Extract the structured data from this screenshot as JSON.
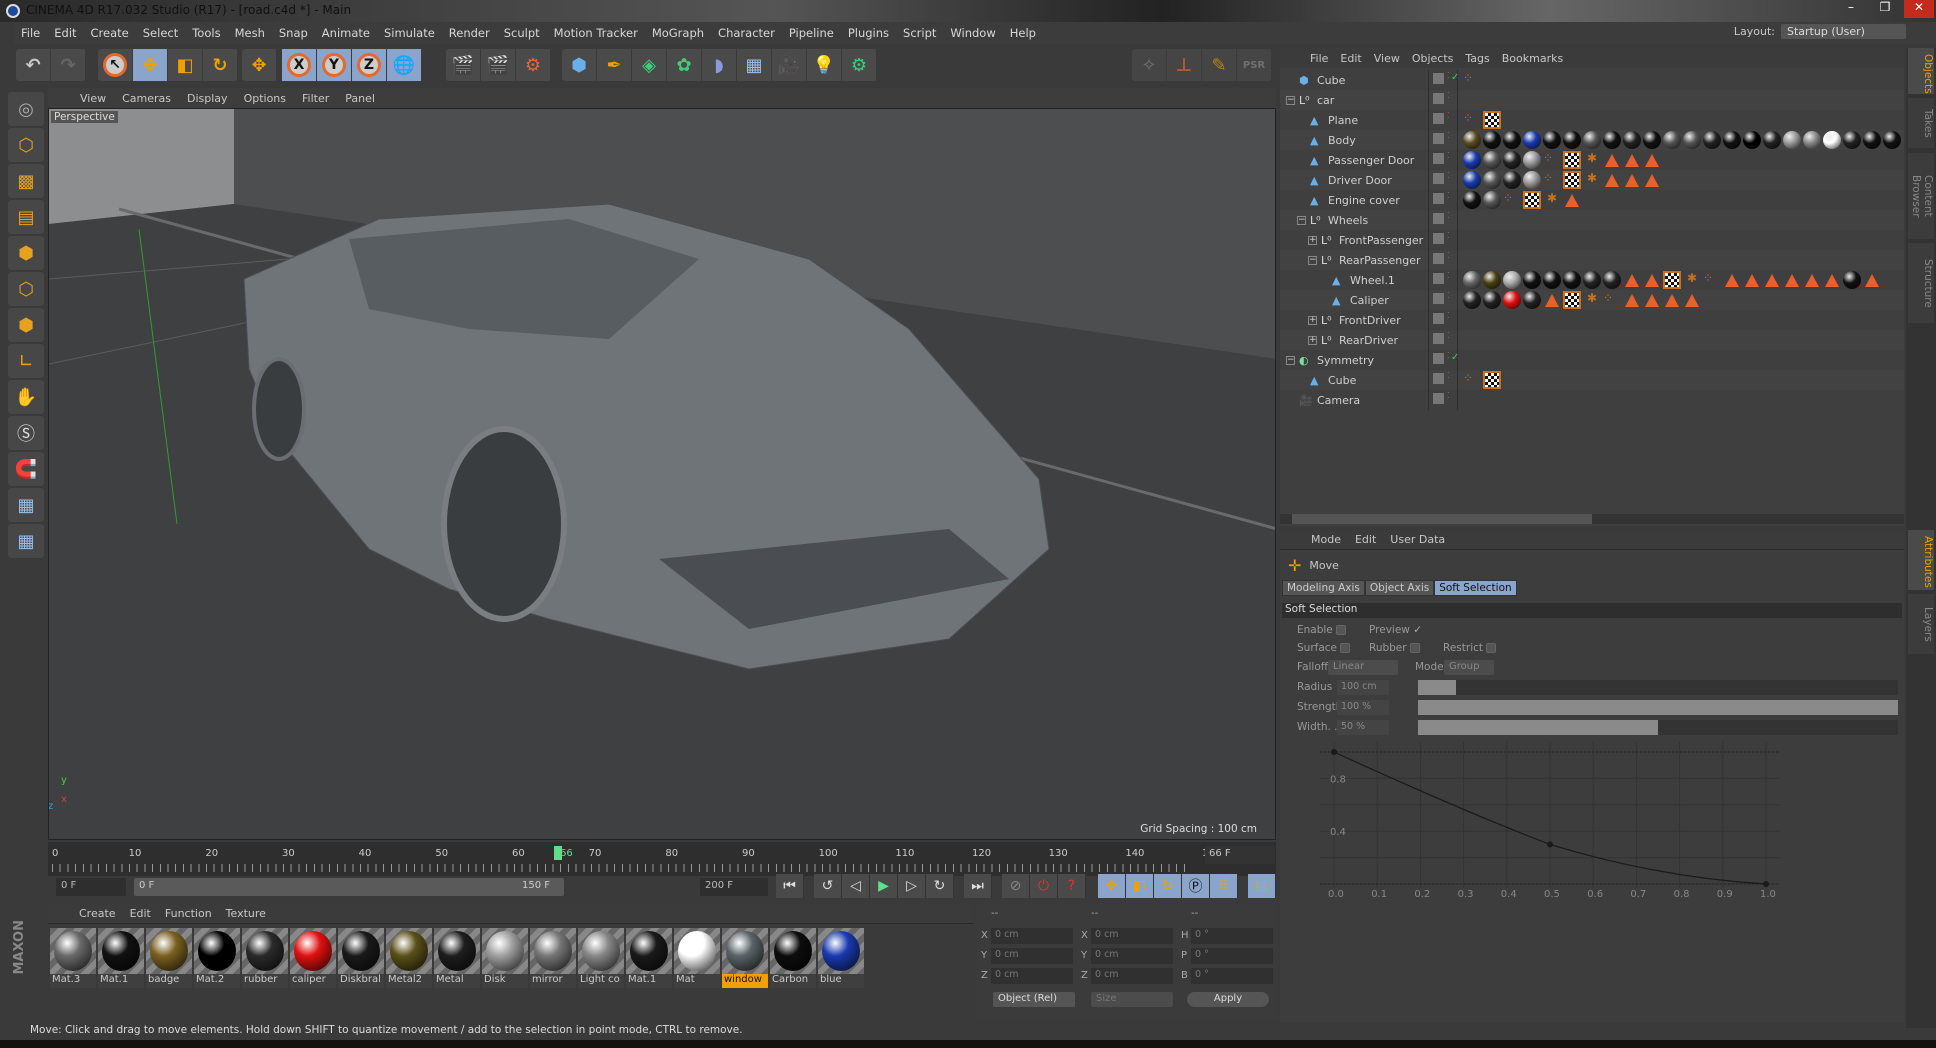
{
  "window": {
    "title": "CINEMA 4D R17.032 Studio (R17) - [road.c4d *] - Main",
    "controls": [
      "–",
      "❐",
      "✕"
    ]
  },
  "menu": [
    "File",
    "Edit",
    "Create",
    "Select",
    "Tools",
    "Mesh",
    "Snap",
    "Animate",
    "Simulate",
    "Render",
    "Sculpt",
    "Motion Tracker",
    "MoGraph",
    "Character",
    "Pipeline",
    "Plugins",
    "Script",
    "Window",
    "Help"
  ],
  "layout": {
    "label": "Layout:",
    "value": "Startup (User)"
  },
  "toolbar": {
    "axis_x": "X",
    "axis_y": "Y",
    "axis_z": "Z"
  },
  "viewport": {
    "menu": [
      "View",
      "Cameras",
      "Display",
      "Options",
      "Filter",
      "Panel"
    ],
    "camera_label": "Perspective",
    "grid_spacing": "Grid Spacing : 100 cm",
    "axis_labels": {
      "x": "x",
      "y": "y",
      "z": "z"
    }
  },
  "timeline": {
    "ticks": [
      "0",
      "10",
      "20",
      "30",
      "40",
      "50",
      "60",
      "70",
      "80",
      "90",
      "100",
      "110",
      "120",
      "130",
      "140",
      "150"
    ],
    "current_frame": 66,
    "current_label": "66",
    "frame_field": "66 F",
    "start_field": "0 F",
    "range_start": "0 F",
    "range_end": "150 F",
    "end_field": "200 F",
    "accent": "#5ee08a"
  },
  "materials": {
    "menu": [
      "Create",
      "Edit",
      "Function",
      "Texture"
    ],
    "items": [
      {
        "name": "Mat.3",
        "color": "#6a6a6a"
      },
      {
        "name": "Mat.1",
        "color": "#111111"
      },
      {
        "name": "badge",
        "color": "#7a6020"
      },
      {
        "name": "Mat.2",
        "color": "#000000"
      },
      {
        "name": "rubber",
        "color": "#2a2a2a"
      },
      {
        "name": "caliper",
        "color": "#e01010"
      },
      {
        "name": "Diskbral",
        "color": "#1a1a1a"
      },
      {
        "name": "Metal2",
        "color": "#5a5018"
      },
      {
        "name": "Metal",
        "color": "#1e1e1e"
      },
      {
        "name": "Disk",
        "color": "#a0a0a0"
      },
      {
        "name": "mirror",
        "color": "#777777"
      },
      {
        "name": "Light co",
        "color": "#888888"
      },
      {
        "name": "Mat.1",
        "color": "#1a1a1a"
      },
      {
        "name": "Mat",
        "color": "#ffffff"
      },
      {
        "name": "window",
        "color": "#5a6468",
        "selected": true
      },
      {
        "name": "Carbon",
        "color": "#0c0c0c"
      },
      {
        "name": "blue",
        "color": "#1a3ab0"
      }
    ]
  },
  "coords": {
    "headers": [
      "--",
      "--",
      "--"
    ],
    "rows": [
      [
        "X",
        "0 cm",
        "X",
        "0 cm",
        "H",
        "0 °"
      ],
      [
        "Y",
        "0 cm",
        "Y",
        "0 cm",
        "P",
        "0 °"
      ],
      [
        "Z",
        "0 cm",
        "Z",
        "0 cm",
        "B",
        "0 °"
      ]
    ],
    "mode": "Object (Rel)",
    "size": "Size",
    "apply": "Apply"
  },
  "status": "Move: Click and drag to move elements. Hold down SHIFT to quantize movement / add to the selection in point mode, CTRL to remove.",
  "objects": {
    "menu": [
      "File",
      "Edit",
      "View",
      "Objects",
      "Tags",
      "Bookmarks"
    ],
    "rows": [
      {
        "name": "Cube",
        "depth": 0,
        "icon": "cube-icon",
        "check": true,
        "tags": [
          "phong"
        ]
      },
      {
        "name": "car",
        "depth": 0,
        "icon": "null-icon",
        "expand": "−",
        "tags": []
      },
      {
        "name": "Plane",
        "depth": 1,
        "icon": "polygon-icon",
        "dot": "red",
        "tags": [
          "phong",
          "uvw"
        ]
      },
      {
        "name": "Body",
        "depth": 1,
        "icon": "polygon-icon",
        "tags": [
          "m:#5a4a20",
          "m:#111",
          "m:#111",
          "m:#1a3ab0",
          "m:#111",
          "m:#111",
          "m:#555",
          "m:#111",
          "m:#222",
          "m:#111",
          "m:#555",
          "m:#555",
          "m:#222",
          "m:#111",
          "m:#000",
          "m:#222",
          "m:#999",
          "m:#888",
          "m:#fff",
          "m:#222",
          "m:#111",
          "m:#111"
        ]
      },
      {
        "name": "Passenger Door",
        "depth": 1,
        "icon": "polygon-icon",
        "tags": [
          "m:#1a3ab0",
          "m:#555",
          "m:#222",
          "m:#999",
          "phong",
          "uvw",
          "bug",
          "sel",
          "sel",
          "sel"
        ]
      },
      {
        "name": "Driver Door",
        "depth": 1,
        "icon": "polygon-icon",
        "tags": [
          "m:#1a3ab0",
          "m:#555",
          "m:#222",
          "m:#999",
          "phong",
          "uvw",
          "bug",
          "sel",
          "sel",
          "sel"
        ]
      },
      {
        "name": "Engine cover",
        "depth": 1,
        "icon": "polygon-icon",
        "tags": [
          "m:#111",
          "m:#555",
          "phong",
          "uvw",
          "bug",
          "sel"
        ]
      },
      {
        "name": "Wheels",
        "depth": 1,
        "icon": "null-icon",
        "expand": "−",
        "tags": []
      },
      {
        "name": "FrontPassenger",
        "depth": 2,
        "icon": "null-icon",
        "expand": "+",
        "tags": []
      },
      {
        "name": "RearPassenger",
        "depth": 2,
        "icon": "null-icon",
        "expand": "−",
        "tags": []
      },
      {
        "name": "Wheel.1",
        "depth": 3,
        "icon": "polygon-icon",
        "tags": [
          "m:#666",
          "m:#4a4010",
          "m:#aaa",
          "m:#111",
          "m:#111",
          "m:#111",
          "m:#222",
          "m:#222",
          "sel",
          "sel",
          "uvw",
          "bug",
          "phong",
          "sel",
          "sel",
          "sel",
          "sel",
          "sel",
          "sel",
          "m:#111",
          "sel"
        ]
      },
      {
        "name": "Caliper",
        "depth": 3,
        "icon": "polygon-icon",
        "tags": [
          "m:#222",
          "m:#222",
          "m:#e01010",
          "m:#222",
          "sel",
          "uvw",
          "bug",
          "phong",
          "sel",
          "sel",
          "sel",
          "sel"
        ]
      },
      {
        "name": "FrontDriver",
        "depth": 2,
        "icon": "null-icon",
        "expand": "+",
        "tags": []
      },
      {
        "name": "RearDriver",
        "depth": 2,
        "icon": "null-icon",
        "expand": "+",
        "tags": []
      },
      {
        "name": "Symmetry",
        "depth": 0,
        "icon": "symmetry-icon",
        "expand": "−",
        "check": true,
        "tags": []
      },
      {
        "name": "Cube",
        "depth": 1,
        "icon": "polygon-icon",
        "tags": [
          "phong",
          "uvw"
        ]
      },
      {
        "name": "Camera",
        "depth": 0,
        "icon": "camera-icon",
        "tags": []
      }
    ]
  },
  "side_tabs_top": [
    "Objects",
    "Takes",
    "Content Browser",
    "Structure"
  ],
  "side_tabs_bottom": [
    "Attributes",
    "Layers"
  ],
  "attributes": {
    "menu": [
      "Mode",
      "Edit",
      "User Data"
    ],
    "tool": "Move",
    "tabs": [
      "Modeling Axis",
      "Object Axis",
      "Soft Selection"
    ],
    "active_tab": "Soft Selection",
    "section": "Soft Selection",
    "enable": {
      "label": "Enable",
      "checked": false
    },
    "preview": {
      "label": "Preview",
      "checked": true
    },
    "surface": {
      "label": "Surface",
      "checked": false
    },
    "rubber": {
      "label": "Rubber",
      "checked": false
    },
    "restrict": {
      "label": "Restrict",
      "checked": false
    },
    "falloff": {
      "label": "Falloff",
      "value": "Linear"
    },
    "mode": {
      "label": "Mode",
      "value": "Group"
    },
    "radius": {
      "label": "Radius",
      "value": "100 cm",
      "fill": 0.08
    },
    "strength": {
      "label": "Strength",
      "value": "100 %",
      "fill": 1.0
    },
    "width": {
      "label": "Width. .",
      "value": "50 %",
      "fill": 0.5
    },
    "curve": {
      "x_ticks": [
        "0.0",
        "0.1",
        "0.2",
        "0.3",
        "0.4",
        "0.5",
        "0.6",
        "0.7",
        "0.8",
        "0.9",
        "1.0"
      ],
      "y_ticks": [
        "0.8",
        "0.4"
      ],
      "points": [
        [
          0,
          1
        ],
        [
          0.5,
          0.3
        ],
        [
          1,
          0
        ]
      ]
    }
  },
  "accent": "#f0a000"
}
